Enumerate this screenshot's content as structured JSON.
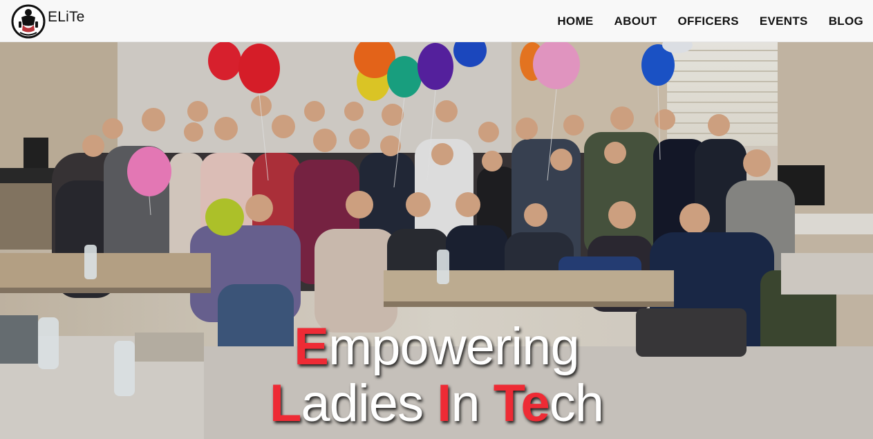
{
  "brand": {
    "name": "ELiTe",
    "logo_icon": "elite-logo-icon"
  },
  "nav": {
    "items": [
      {
        "label": "HOME"
      },
      {
        "label": "ABOUT"
      },
      {
        "label": "OFFICERS"
      },
      {
        "label": "EVENTS"
      },
      {
        "label": "BLOG"
      }
    ]
  },
  "hero": {
    "line1": {
      "hl1": "E",
      "rest1": "mpowering"
    },
    "line2": {
      "hl1": "L",
      "rest1": "adies ",
      "hl2": "I",
      "rest2": "n ",
      "hl3": "Te",
      "rest3": "ch"
    },
    "highlight_color": "#ee2b35",
    "photo": "group-photo-of-members-with-balloons"
  },
  "colors": {
    "navbar_bg": "#f8f8f8",
    "nav_text": "#111111",
    "accent": "#ee2b35"
  }
}
